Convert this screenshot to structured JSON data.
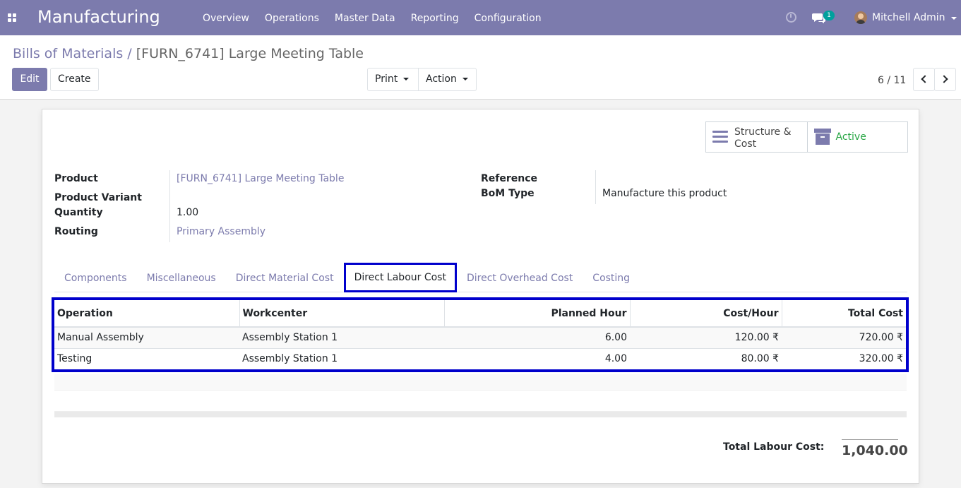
{
  "navbar": {
    "app_name": "Manufacturing",
    "menu": [
      "Overview",
      "Operations",
      "Master Data",
      "Reporting",
      "Configuration"
    ],
    "chat_badge": "1",
    "user_name": "Mitchell Admin",
    "color": "#7c7bad"
  },
  "breadcrumb": {
    "parent": "Bills of Materials",
    "separator": "/",
    "current": "[FURN_6741] Large Meeting Table"
  },
  "toolbar": {
    "edit_label": "Edit",
    "create_label": "Create",
    "print_label": "Print",
    "action_label": "Action"
  },
  "pager": {
    "value": "6 / 11"
  },
  "smart_buttons": {
    "structure_line1": "Structure &",
    "structure_line2": "Cost",
    "active_label": "Active"
  },
  "fields": {
    "product_label": "Product",
    "product_value": "[FURN_6741] Large Meeting Table",
    "variant_label": "Product Variant",
    "quantity_label": "Quantity",
    "quantity_value": "1.00",
    "routing_label": "Routing",
    "routing_value": "Primary Assembly",
    "reference_label": "Reference",
    "bom_type_label": "BoM Type",
    "bom_type_value": "Manufacture this product"
  },
  "tabs": [
    "Components",
    "Miscellaneous",
    "Direct Material Cost",
    "Direct Labour Cost",
    "Direct Overhead Cost",
    "Costing"
  ],
  "labour_table": {
    "headers": [
      "Operation",
      "Workcenter",
      "Planned Hour",
      "Cost/Hour",
      "Total Cost"
    ],
    "rows": [
      [
        "Manual Assembly",
        "Assembly Station 1",
        "6.00",
        "120.00 ₹",
        "720.00 ₹"
      ],
      [
        "Testing",
        "Assembly Station 1",
        "4.00",
        "80.00 ₹",
        "320.00 ₹"
      ]
    ]
  },
  "total": {
    "label": "Total Labour Cost:",
    "value": "1,040.00"
  }
}
